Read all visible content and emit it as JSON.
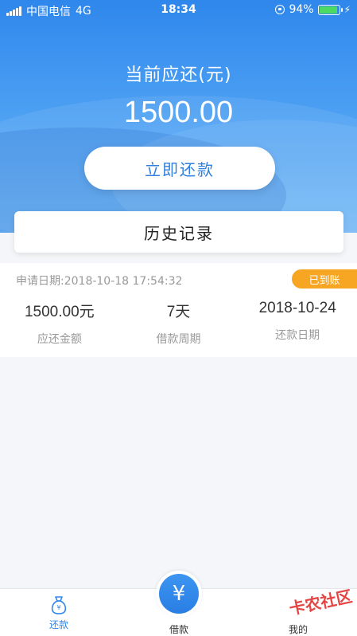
{
  "status_bar": {
    "carrier": "中国电信",
    "network": "4G",
    "time": "18:34",
    "battery": "94%",
    "battery_level": 0.94
  },
  "header": {
    "title": "当前应还(元)",
    "amount": "1500.00",
    "repay_button": "立即还款"
  },
  "history": {
    "label": "历史记录"
  },
  "record": {
    "apply_date": "申请日期:2018-10-18 17:54:32",
    "status_badge": "已到账",
    "columns": [
      {
        "value": "1500.00元",
        "label": "应还金额"
      },
      {
        "value": "7天",
        "label": "借款周期"
      },
      {
        "value": "2018-10-24",
        "label": "还款日期"
      }
    ]
  },
  "tabbar": {
    "items": [
      {
        "label": "还款",
        "icon": "money-bag-icon",
        "active": true
      },
      {
        "label": "借款",
        "icon": "yen-icon",
        "active": false
      },
      {
        "label": "我的",
        "icon": "user-icon",
        "active": false
      }
    ],
    "center_symbol": "¥"
  },
  "watermark": "卡农社区",
  "colors": {
    "primary": "#2f87ec",
    "badge": "#f6a623",
    "battery": "#4cd964"
  }
}
